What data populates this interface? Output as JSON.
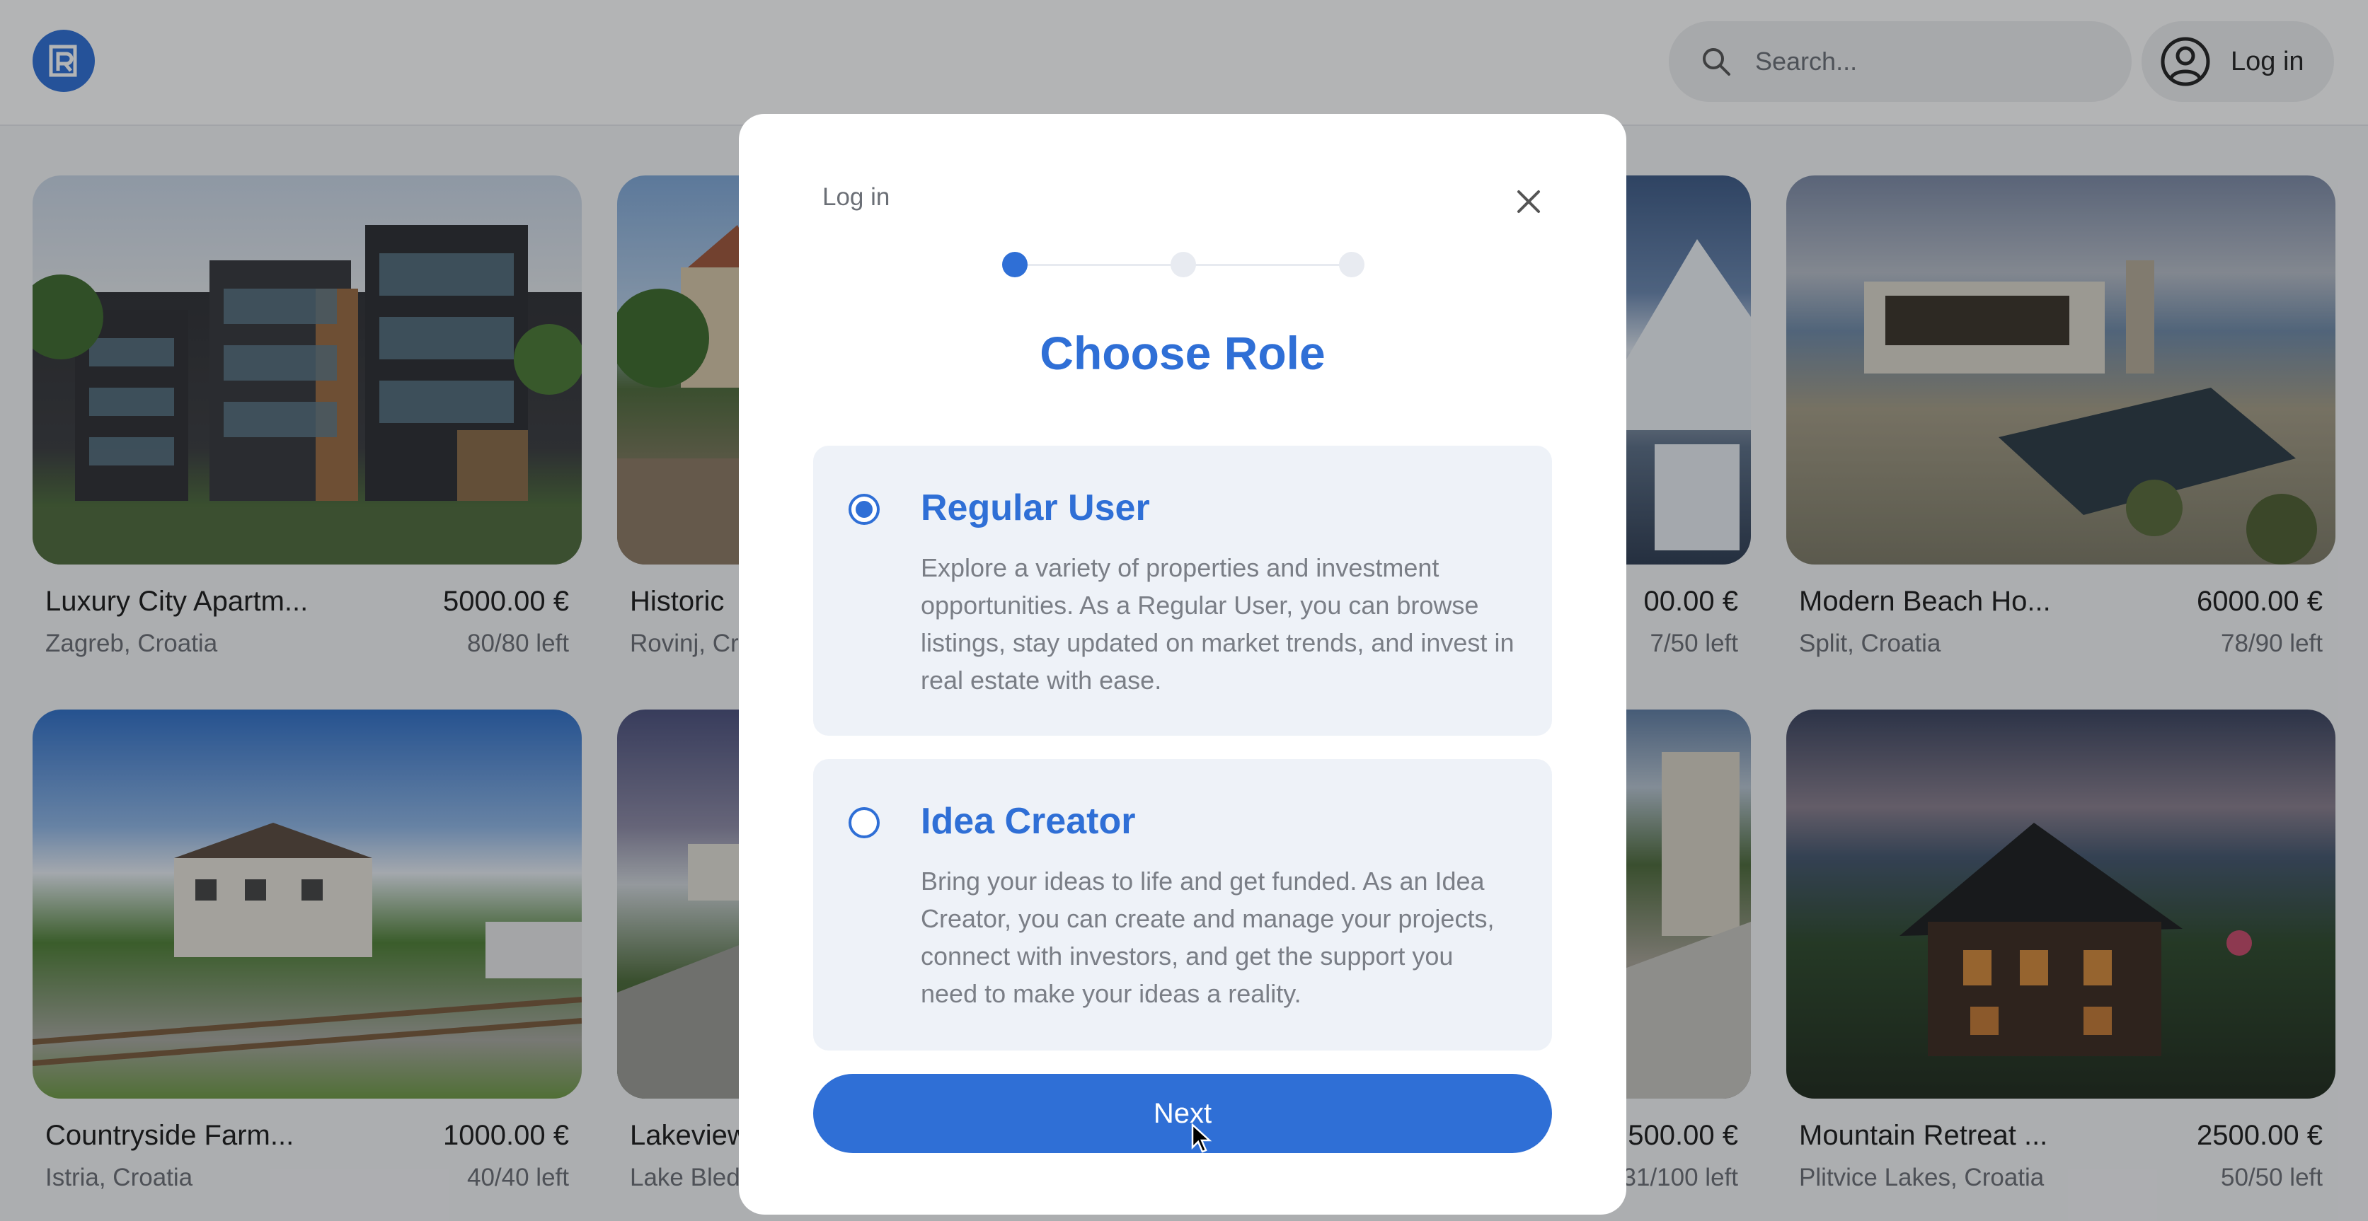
{
  "header": {
    "logo_icon": "logo-mark-icon",
    "search": {
      "placeholder": "Search...",
      "icon": "search-icon"
    },
    "login": {
      "label": "Log in",
      "icon": "user-circle-icon"
    }
  },
  "cards": [
    {
      "title": "Luxury City Apartm...",
      "price": "5000.00 €",
      "location": "Zagreb, Croatia",
      "availability": "80/80 left"
    },
    {
      "title": "Historic",
      "price": "",
      "location": "Rovinj, Cr",
      "availability": ""
    },
    {
      "title": "",
      "price": "00.00 €",
      "location": "",
      "availability": "7/50 left"
    },
    {
      "title": "Modern Beach Ho...",
      "price": "6000.00 €",
      "location": "Split, Croatia",
      "availability": "78/90 left"
    },
    {
      "title": "Countryside Farm...",
      "price": "1000.00 €",
      "location": "Istria, Croatia",
      "availability": "40/40 left"
    },
    {
      "title": "Lakeview",
      "price": "",
      "location": "Lake Bled",
      "availability": ""
    },
    {
      "title": "",
      "price": "500.00 €",
      "location": "",
      "availability": "31/100 left"
    },
    {
      "title": "Mountain Retreat ...",
      "price": "2500.00 €",
      "location": "Plitvice Lakes, Croatia",
      "availability": "50/50 left"
    }
  ],
  "modal": {
    "title": "Log in",
    "close_icon": "close-icon",
    "steps": {
      "total": 3,
      "current": 1
    },
    "heading": "Choose Role",
    "roles": [
      {
        "title": "Regular User",
        "selected": true,
        "description": "Explore a variety of properties and investment opportunities. As a Regular User, you can browse listings, stay updated on market trends, and invest in real estate with ease."
      },
      {
        "title": "Idea Creator",
        "selected": false,
        "description": "Bring your ideas to life and get funded. As an Idea Creator, you can create and manage your projects, connect with investors, and get the support you need to make your ideas a reality."
      }
    ],
    "next_label": "Next"
  },
  "colors": {
    "accent": "#2f6fd6",
    "role_card_bg": "#eef2f8",
    "overlay": "rgba(20,22,26,0.32)"
  }
}
